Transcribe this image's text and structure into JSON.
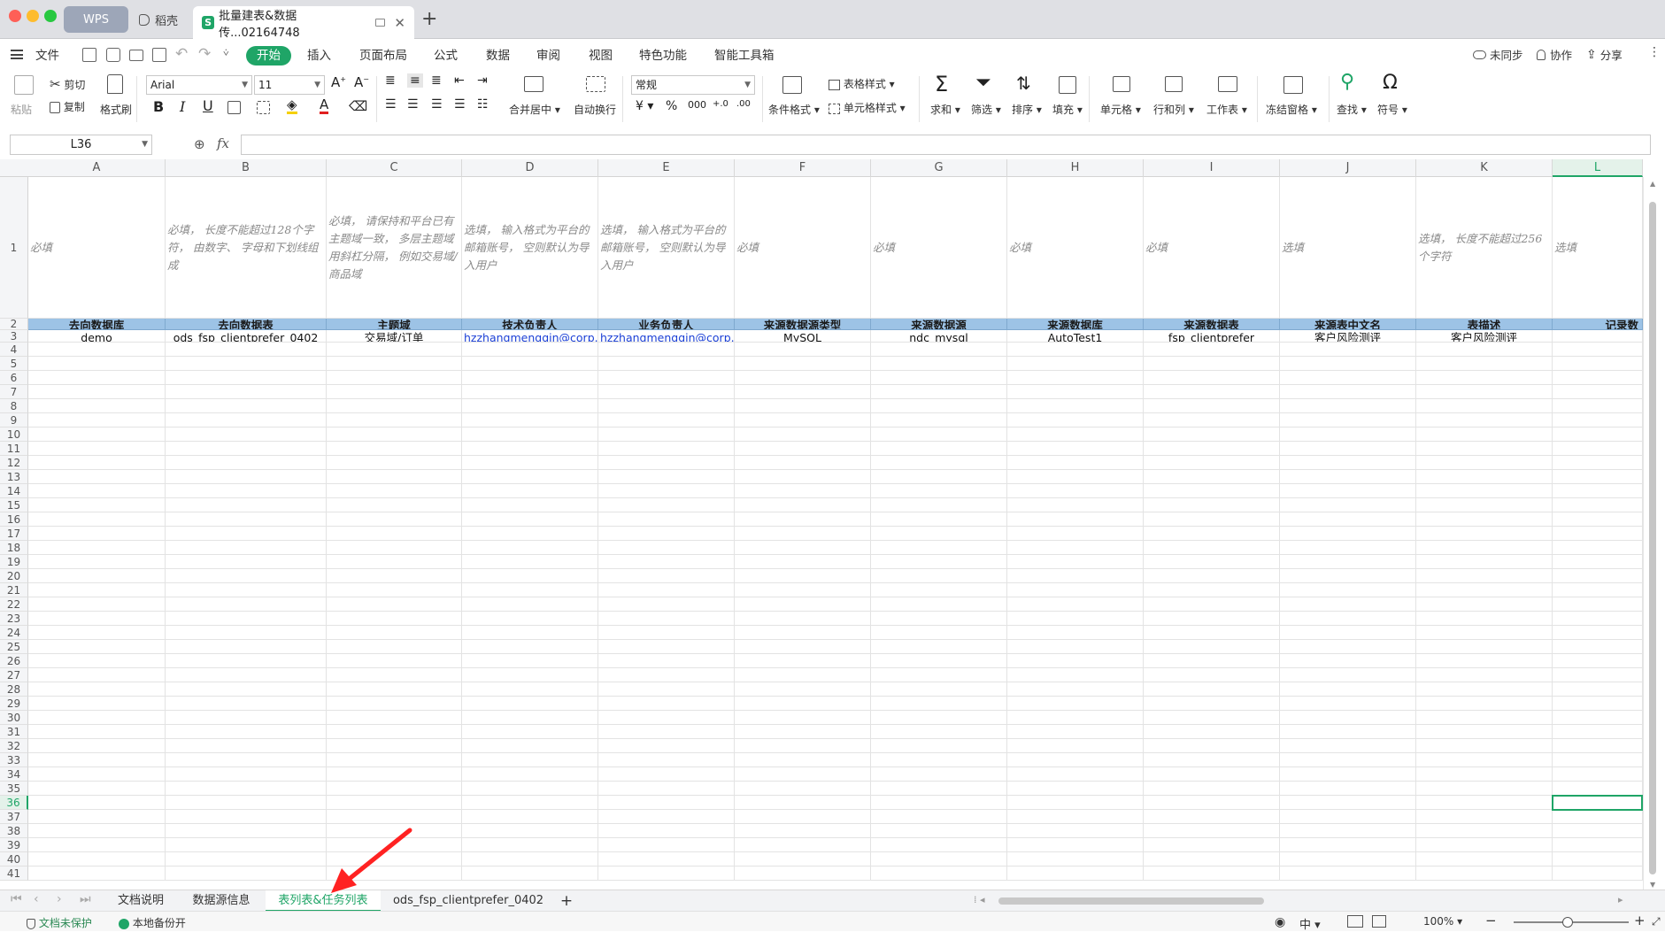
{
  "titlebar": {
    "tabs": [
      {
        "label": "WPS"
      },
      {
        "label": "稻壳"
      },
      {
        "label": "批量建表&数据传...02164748"
      }
    ],
    "new_tab": "+"
  },
  "menu": {
    "file": "文件",
    "items": [
      "开始",
      "插入",
      "页面布局",
      "公式",
      "数据",
      "审阅",
      "视图",
      "特色功能",
      "智能工具箱"
    ],
    "right": [
      "未同步",
      "协作",
      "分享"
    ]
  },
  "ribbon": {
    "paste": "粘贴",
    "cut": "剪切",
    "copy": "复制",
    "format_painter": "格式刷",
    "font_name": "Arial",
    "font_size": "11",
    "merge_center": "合并居中",
    "wrap_text": "自动换行",
    "number_format": "常规",
    "conditional_format": "条件格式",
    "table_style": "表格样式",
    "cell_style": "单元格样式",
    "sum": "求和",
    "filter": "筛选",
    "sort": "排序",
    "fill": "填充",
    "cell": "单元格",
    "row_col": "行和列",
    "worksheet": "工作表",
    "freeze": "冻结窗格",
    "find": "查找",
    "symbol": "符号"
  },
  "formula": {
    "name_box": "L36",
    "fx": "fx",
    "value": ""
  },
  "grid": {
    "columns": [
      "A",
      "B",
      "C",
      "D",
      "E",
      "F",
      "G",
      "H",
      "I",
      "J",
      "K",
      "L"
    ],
    "selected_column": "L",
    "selected_row": "36",
    "row_count": 41,
    "hint_row": [
      "必填",
      "必填， 长度不能超过128个字符， 由数字、 字母和下划线组成",
      "必填， 请保持和平台已有主题域一致， 多层主题域用斜杠分隔， 例如交易域/商品域",
      "选填， 输入格式为平台的邮箱账号， 空则默认为导入用户",
      "选填， 输入格式为平台的邮箱账号， 空则默认为导入用户",
      "必填",
      "必填",
      "必填",
      "必填",
      "选填",
      "选填， 长度不能超过256个字符",
      "选填"
    ],
    "header_row": [
      "去向数据库",
      "去向数据表",
      "主题域",
      "技术负责人",
      "业务负责人",
      "来源数据源类型",
      "来源数据源",
      "来源数据库",
      "来源数据表",
      "来源表中文名",
      "表描述",
      "记录数"
    ],
    "data_row": [
      "demo",
      "ods_fsp_clientprefer_0402",
      "交易域/订单",
      "hzzhangmengqin@corp.ne",
      "hzzhangmengqin@corp.ne",
      "MySQL",
      "ndc_mysql",
      "AutoTest1",
      "fsp_clientprefer",
      "客户风险测评",
      "客户风险测评",
      ""
    ]
  },
  "sheets": {
    "tabs": [
      "文档说明",
      "数据源信息",
      "表列表&任务列表",
      "ods_fsp_clientprefer_0402"
    ],
    "active": "表列表&任务列表",
    "add": "+"
  },
  "status": {
    "protect": "文档未保护",
    "backup": "本地备份开",
    "zoom": "100%"
  },
  "colors": {
    "accent": "#1fa567",
    "header_fill": "#9dc3e6",
    "link": "#1a3fd6",
    "arrow": "#ff2222"
  }
}
